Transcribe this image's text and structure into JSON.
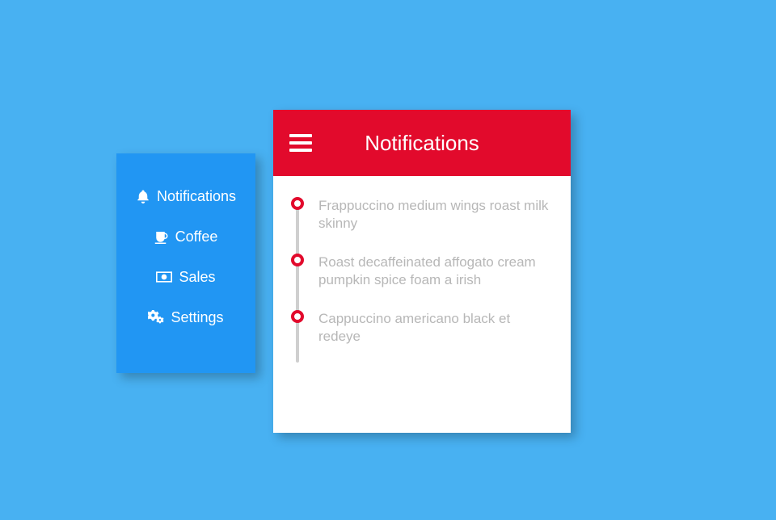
{
  "sidebar": {
    "items": [
      {
        "icon": "bell",
        "label": "Notifications"
      },
      {
        "icon": "coffee",
        "label": "Coffee"
      },
      {
        "icon": "money",
        "label": "Sales"
      },
      {
        "icon": "cogs",
        "label": "Settings"
      }
    ]
  },
  "card": {
    "title": "Notifications",
    "notifications": [
      "Frappuccino medium wings roast milk skinny",
      "Roast decaffeinated affogato cream pumpkin spice foam a irish",
      "Cappuccino americano black et redeye"
    ]
  },
  "colors": {
    "primary_red": "#e20a2c",
    "sidebar_blue": "#2196f3",
    "page_bg": "#48b1f2"
  }
}
